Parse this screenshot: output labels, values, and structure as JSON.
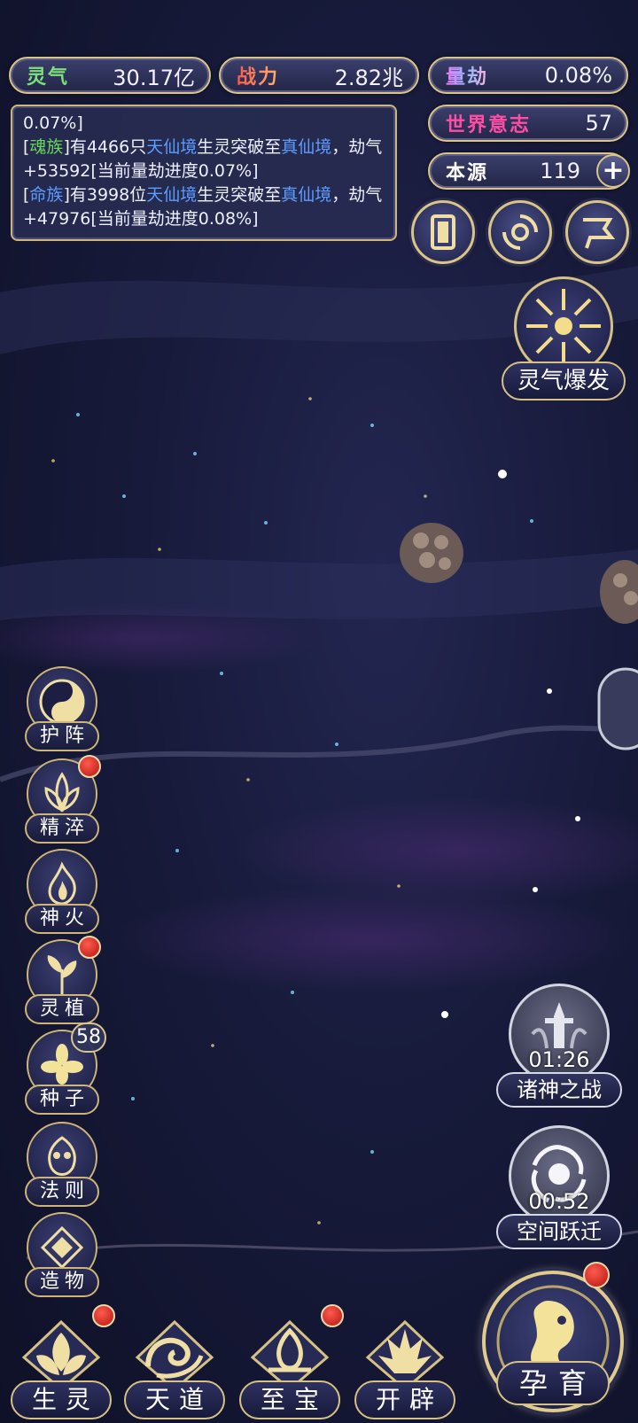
{
  "resources": {
    "lingqi": {
      "label": "灵气",
      "value": "30.17亿"
    },
    "zhanli": {
      "label": "战力",
      "value": "2.82兆"
    },
    "liangjie": {
      "label": "量劫",
      "value": "0.08%"
    },
    "shijie": {
      "label": "世界意志",
      "value": "57"
    },
    "benyuan": {
      "label": "本源",
      "value": "119",
      "plus": "+"
    }
  },
  "log": {
    "line0": "0.07%]",
    "entries": [
      {
        "b1": "[",
        "tribe": "魂族",
        "b2": "]",
        "t1": "有4466只",
        "realm1": "天仙境",
        "t2": "生灵突破至",
        "realm2": "真仙境",
        "t3": "，劫气+53592[当前量劫进度0.07%]"
      },
      {
        "b1": "[",
        "tribe": "命族",
        "b2": "]",
        "t1": "有3998位",
        "realm1": "天仙境",
        "t2": "生灵突破至",
        "realm2": "真仙境",
        "t3": "，劫气+47976[当前量劫进度0.08%]"
      }
    ]
  },
  "top_icons": [
    "card-icon",
    "vortex-icon",
    "flag-icon"
  ],
  "burst": {
    "label": "灵气爆发"
  },
  "side_menu": [
    {
      "label": "护阵",
      "icon": "yin-yang-icon",
      "dot": false
    },
    {
      "label": "精淬",
      "icon": "lotus-icon",
      "dot": true
    },
    {
      "label": "神火",
      "icon": "flame-icon",
      "dot": false
    },
    {
      "label": "灵植",
      "icon": "plant-icon",
      "dot": true
    },
    {
      "label": "种子",
      "icon": "flower-seed-icon",
      "dot": false,
      "badge": "58"
    },
    {
      "label": "法则",
      "icon": "law-icon",
      "dot": false
    },
    {
      "label": "造物",
      "icon": "creation-icon",
      "dot": false
    }
  ],
  "timers": [
    {
      "label": "诸神之战",
      "time": "01:26",
      "icon": "sword-icon"
    },
    {
      "label": "空间跃迁",
      "time": "00:52",
      "icon": "spiral-icon"
    }
  ],
  "bottom_nav": [
    {
      "label": "生灵",
      "icon": "life-icon",
      "dot": true
    },
    {
      "label": "天道",
      "icon": "heaven-icon",
      "dot": false
    },
    {
      "label": "至宝",
      "icon": "treasure-icon",
      "dot": true
    },
    {
      "label": "开辟",
      "icon": "creation-flame-icon",
      "dot": false
    }
  ],
  "nurture": {
    "label": "孕育",
    "dot": true
  },
  "colors": {
    "gold": "#d8c58a",
    "panel": "#2a2d58",
    "bg": "#171a3a",
    "red_dot": "#d0251b"
  }
}
